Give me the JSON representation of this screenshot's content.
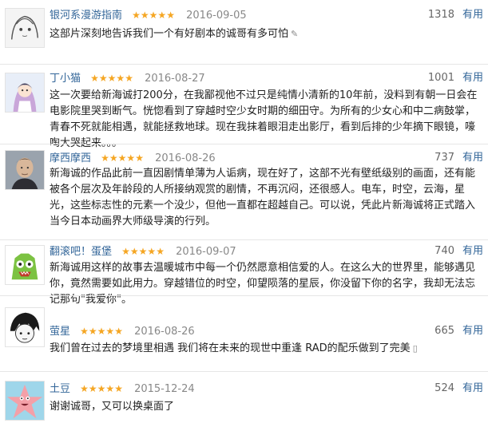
{
  "reviews": [
    {
      "username": "银河系漫游指南",
      "stars": "★★★★★",
      "date": "2016-09-05",
      "useful_count": "1318",
      "useful_label": "有用",
      "comment": "这部片深刻地告诉我们一个有好剧本的诚哥有多可怕",
      "trailing_icon": "✎",
      "avatar": "anime-sketch-avatar"
    },
    {
      "username": "丁小猫",
      "stars": "★★★★★",
      "date": "2016-08-27",
      "useful_count": "1001",
      "useful_label": "有用",
      "comment": "这一次要给新海诚打200分，在我鄙视他不过只是纯情小清新的10年前，没料到有朝一日会在电影院里哭到断气。恍惚看到了穿越时空少女时期的细田守。为所有的少女心和中二病鼓掌，青春不死就能相遇，就能拯救地球。现在我抹着眼泪走出影厅，看到后排的少年摘下眼镜，嚎啕大哭起来。。。",
      "avatar": "anime-girl-avatar"
    },
    {
      "username": "摩西摩西",
      "stars": "★★★★★",
      "date": "2016-08-26",
      "useful_count": "737",
      "useful_label": "有用",
      "comment": "新海诚的作品此前一直因剧情单薄为人诟病，现在好了，这部不光有壁纸级别的画面，还有能被各个层次及年龄段的人所接纳观赏的剧情，不再沉闷，还很感人。电车，时空，云海，星光，这些标志性的元素一个没少，但他一直都在超越自己。可以说，凭此片新海诚将正式踏入当今日本动画界大师级导演的行列。",
      "avatar": "man-photo-avatar"
    },
    {
      "username": "翻滚吧！蛋堡",
      "stars": "★★★★★",
      "date": "2016-09-07",
      "useful_count": "740",
      "useful_label": "有用",
      "comment": "新海诚用这样的故事去温暖城市中每一个仍然愿意相信爱的人。在这么大的世界里，能够遇见你，竟然需要如此用力。穿越错位的时空，仰望陨落的星辰，你没留下你的名字，我却无法忘记那句\"我爱你\"。",
      "avatar": "green-monster-avatar"
    },
    {
      "username": "萤星",
      "stars": "★★★★★",
      "date": "2016-08-26",
      "useful_count": "665",
      "useful_label": "有用",
      "comment": "我们曾在过去的梦境里相遇 我们将在未来的现世中重逢 RAD的配乐做到了完美",
      "trailing_icon": "▯",
      "avatar": "manga-boy-avatar"
    },
    {
      "username": "土豆",
      "stars": "★★★★★",
      "date": "2015-12-24",
      "useful_count": "524",
      "useful_label": "有用",
      "comment": "谢谢诚哥，又可以换桌面了",
      "avatar": "pink-starfish-avatar"
    }
  ]
}
